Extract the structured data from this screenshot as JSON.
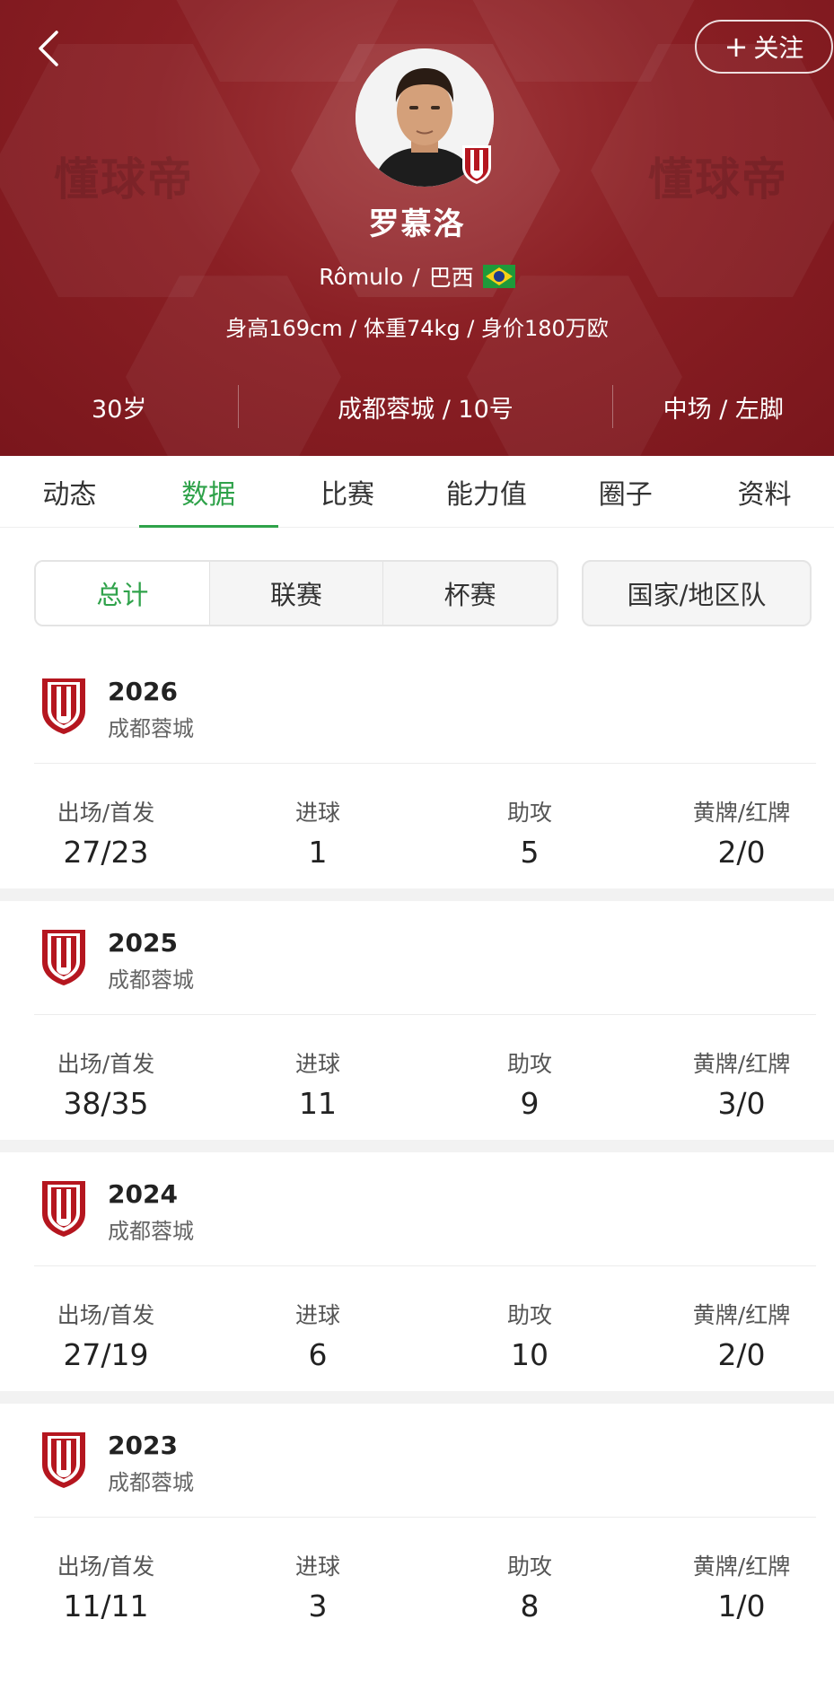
{
  "header": {
    "watermark": "懂球帝",
    "follow_label": "关注",
    "follow_plus": "+",
    "player_name": "罗慕洛",
    "player_name_latin": "Rômulo",
    "separator": "/",
    "nationality": "巴西",
    "physical": "身高169cm / 体重74kg / 身价180万欧",
    "age": "30岁",
    "club_number": "成都蓉城 / 10号",
    "position_foot": "中场 / 左脚",
    "colors": {
      "bg": "#8a1f24",
      "accent": "#2fa24a"
    }
  },
  "tabs": [
    {
      "label": "动态"
    },
    {
      "label": "数据"
    },
    {
      "label": "比赛"
    },
    {
      "label": "能力值"
    },
    {
      "label": "圈子"
    },
    {
      "label": "资料"
    }
  ],
  "filters": {
    "segments": [
      {
        "label": "总计"
      },
      {
        "label": "联赛"
      },
      {
        "label": "杯赛"
      }
    ],
    "national_label": "国家/地区队"
  },
  "stat_labels": {
    "apps": "出场/首发",
    "goals": "进球",
    "assists": "助攻",
    "cards": "黄牌/红牌"
  },
  "seasons": [
    {
      "year": "2026",
      "team": "成都蓉城",
      "apps": "27/23",
      "goals": "1",
      "assists": "5",
      "cards": "2/0"
    },
    {
      "year": "2025",
      "team": "成都蓉城",
      "apps": "38/35",
      "goals": "11",
      "assists": "9",
      "cards": "3/0"
    },
    {
      "year": "2024",
      "team": "成都蓉城",
      "apps": "27/19",
      "goals": "6",
      "assists": "10",
      "cards": "2/0"
    },
    {
      "year": "2023",
      "team": "成都蓉城",
      "apps": "11/11",
      "goals": "3",
      "assists": "8",
      "cards": "1/0"
    }
  ]
}
